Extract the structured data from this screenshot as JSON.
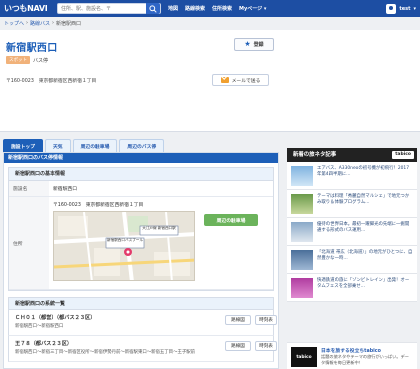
{
  "topbar": {
    "logo": "いつもNAVI",
    "search_placeholder": "住所、駅、施設名、〒",
    "nav": [
      "地図",
      "路線検索",
      "住所検索",
      "Myページ ▾"
    ],
    "user": "test",
    "user_caret": "▾"
  },
  "breadcrumb": [
    "トップへ",
    "›",
    "路線バス",
    "›",
    "新宿駅西口"
  ],
  "page": {
    "title": "新宿駅西口",
    "register_label": "登録",
    "tag": "スポット",
    "category": "バス停",
    "address": "〒160-0023　東京都新宿区西新宿１丁目",
    "mail_label": "メールで送る"
  },
  "tabs": [
    "施設トップ",
    "天気",
    "周辺の駐車場",
    "周辺のバス停"
  ],
  "main": {
    "section_title": "新宿駅西口のバス停情報",
    "basic_title": "新宿駅西口の基本情報",
    "rows": [
      {
        "label": "施設名",
        "value": "新宿駅西口"
      },
      {
        "label": "住所",
        "value": "〒160-0023　東京都新宿区西新宿１丁目"
      }
    ],
    "parking_button": "周辺の駐車場",
    "map_labels": [
      "大江戸線 新宿西口駅",
      "新宿駅西口バスプール"
    ],
    "route_title": "新宿駅西口の系統一覧",
    "routes": [
      {
        "name": "ＣＨ０１（都営）（都バス２３区）",
        "stops": "新宿駅西口〜新宿駅西口",
        "btn_a": "路線図",
        "btn_b": "時刻表"
      },
      {
        "name": "王７８（都バス２３区）",
        "stops": "新宿駅西口〜新宿三丁目〜新宿区役所〜新宿伊勢丹前〜新宿駅東口〜新宿五丁目〜王子駅前",
        "btn_a": "路線図",
        "btn_b": "時刻表"
      }
    ]
  },
  "sidebar": {
    "news_title": "新着の旅ネタ記事",
    "news_brand": "tabico",
    "news": [
      {
        "text": "エアバス、A330neoの初号機が初飛行！2017年第4四半期に…"
      },
      {
        "text": "テーマは料理「秀麗自然マルシェ」で地元つかみ取り＆体験プログラム…"
      },
      {
        "text": "優待の世界日本。最初一躍脚光の先端に一掘開通する形式のバス運用…"
      },
      {
        "text": "「北海道 帯広（北海道）」の地元がひとつに、自然豊かな一時…"
      },
      {
        "text": "快適鉄道の旅に「ゾンビトレイン」出発！オータムフェスを全部乗せ…"
      }
    ],
    "promo_logo": "tabico",
    "promo_title": "日本を旅する役立ちtabico",
    "promo_text": "話題の旅ネタやテーマの旅行がいっぱい。データ情報を毎日更新中！"
  }
}
